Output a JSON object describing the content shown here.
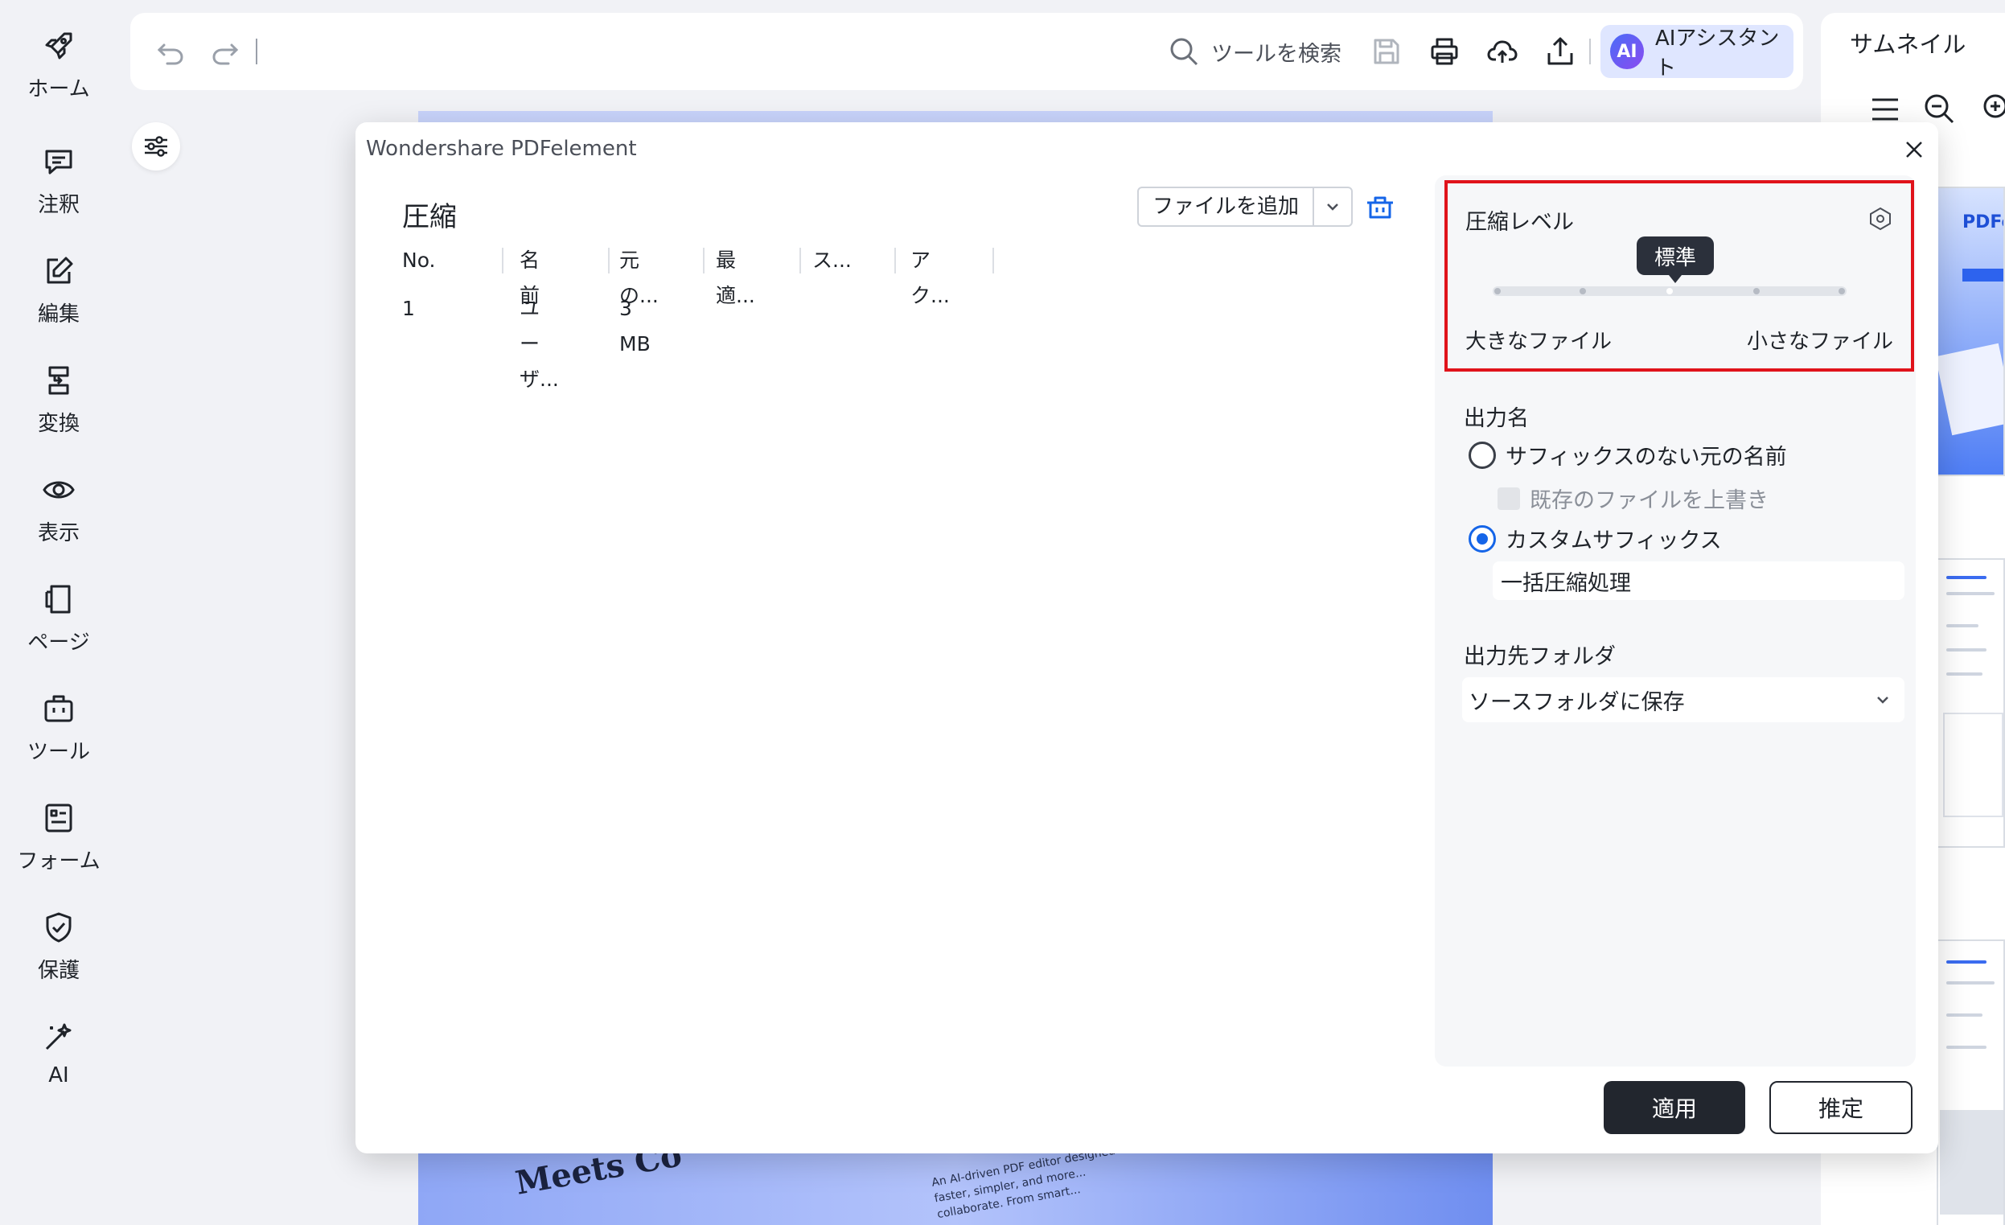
{
  "nav": {
    "items": [
      {
        "label": "ホーム",
        "icon": "rocket-icon"
      },
      {
        "label": "注釈",
        "icon": "comment-icon"
      },
      {
        "label": "編集",
        "icon": "edit-icon"
      },
      {
        "label": "変換",
        "icon": "convert-icon"
      },
      {
        "label": "表示",
        "icon": "eye-icon"
      },
      {
        "label": "ページ",
        "icon": "pages-icon"
      },
      {
        "label": "ツール",
        "icon": "toolbox-icon"
      },
      {
        "label": "フォーム",
        "icon": "form-icon"
      },
      {
        "label": "保護",
        "icon": "shield-icon"
      },
      {
        "label": "AI",
        "icon": "magic-wand-icon"
      }
    ]
  },
  "toolbar": {
    "search_label": "ツールを検索",
    "ai_badge": "AI",
    "ai_label": "AIアシスタント"
  },
  "right_panel": {
    "title": "サムネイル"
  },
  "document": {
    "heading": "Meets Co",
    "snippet": "An AI-driven PDF editor designed for faster, simpler, and more... collaborate. From smart..."
  },
  "dialog": {
    "window_title": "Wondershare PDFelement",
    "title": "圧縮",
    "add_file_label": "ファイルを追加",
    "table": {
      "headers": [
        "No.",
        "名前",
        "元の...",
        "最適...",
        "ス...",
        "アク..."
      ],
      "rows": [
        {
          "no": "1",
          "name": "ユーザ...",
          "original": "3 MB"
        }
      ]
    },
    "compression": {
      "title": "圧縮レベル",
      "selected": "標準",
      "level_fraction": 0.5,
      "left_label": "大きなファイル",
      "right_label": "小さなファイル"
    },
    "output_name": {
      "title": "出力名",
      "option1": "サフィックスのない元の名前",
      "overwrite_label": "既存のファイルを上書き",
      "option2": "カスタムサフィックス",
      "suffix_value": "一括圧縮処理",
      "selected": "option2"
    },
    "destination": {
      "title": "出力先フォルダ",
      "value": "ソースフォルダに保存"
    },
    "apply_label": "適用",
    "estimate_label": "推定"
  },
  "colors": {
    "highlight_border": "#e0131b",
    "radio_active": "#1565e8",
    "primary_button": "#22262e"
  }
}
